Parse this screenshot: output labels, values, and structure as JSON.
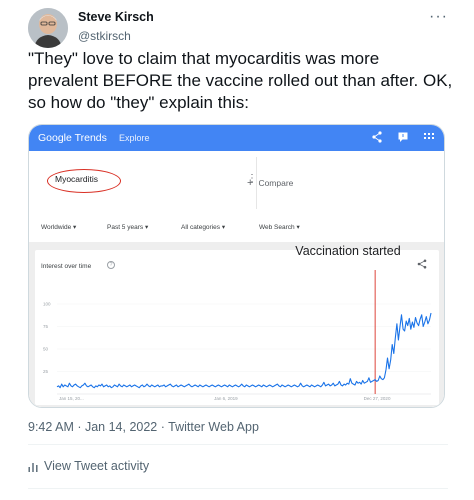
{
  "tweet": {
    "author_name": "Steve Kirsch",
    "author_handle": "@stkirsch",
    "text": "\"They\" love to claim that myocarditis was more prevalent BEFORE the vaccine rolled out than after. OK, so how do \"they\" explain this:",
    "timestamp": "9:42 AM · Jan 14, 2022 · Twitter Web App",
    "activity_label": "View Tweet activity"
  },
  "google_trends": {
    "logo": "Google Trends",
    "nav_explore": "Explore",
    "search_term": "Myocarditis",
    "compare_label": "Compare",
    "filters": [
      "Worldwide",
      "Past 5 years",
      "All categories",
      "Web Search"
    ],
    "panel_title": "Interest over time",
    "annotation": "Vaccination started",
    "colors": {
      "brand": "#4285f4",
      "line": "#1a73e8",
      "marker": "#d93025"
    }
  },
  "chart_data": {
    "type": "line",
    "title": "Interest over time",
    "ylim": [
      0,
      100
    ],
    "yticks": [
      25,
      50,
      75,
      100
    ],
    "xtick_labels": [
      "Jan 15, 20...",
      "Jan 6, 2019",
      "Dec 27, 2020"
    ],
    "annotation": {
      "label": "Vaccination started",
      "x_index": 205
    },
    "series": [
      {
        "values": [
          8,
          9,
          7,
          11,
          8,
          10,
          9,
          8,
          12,
          9,
          8,
          10,
          11,
          9,
          8,
          7,
          9,
          10,
          12,
          9,
          8,
          9,
          10,
          8,
          7,
          9,
          8,
          10,
          9,
          11,
          8,
          9,
          10,
          8,
          9,
          7,
          8,
          10,
          9,
          8,
          11,
          9,
          8,
          10,
          9,
          8,
          9,
          10,
          8,
          9,
          10,
          9,
          8,
          7,
          9,
          10,
          8,
          9,
          11,
          9,
          8,
          10,
          9,
          8,
          9,
          10,
          8,
          9,
          9,
          10,
          8,
          9,
          10,
          11,
          9,
          8,
          9,
          10,
          8,
          9,
          10,
          9,
          8,
          9,
          10,
          11,
          9,
          8,
          9,
          10,
          9,
          8,
          10,
          9,
          8,
          9,
          10,
          9,
          8,
          9,
          10,
          9,
          8,
          9,
          10,
          9,
          8,
          9,
          10,
          9,
          8,
          10,
          9,
          8,
          9,
          10,
          9,
          8,
          9,
          11,
          9,
          8,
          10,
          9,
          8,
          9,
          10,
          9,
          8,
          9,
          10,
          9,
          8,
          10,
          9,
          8,
          9,
          10,
          9,
          8,
          9,
          10,
          11,
          9,
          8,
          10,
          9,
          8,
          9,
          10,
          9,
          8,
          9,
          10,
          9,
          8,
          9,
          12,
          9,
          8,
          9,
          10,
          9,
          8,
          10,
          9,
          8,
          9,
          10,
          9,
          8,
          10,
          13,
          9,
          10,
          11,
          9,
          10,
          12,
          9,
          10,
          11,
          14,
          10,
          9,
          11,
          10,
          12,
          11,
          17,
          12,
          11,
          10,
          14,
          12,
          13,
          11,
          15,
          12,
          13,
          14,
          18,
          13,
          14,
          15,
          16,
          14,
          15,
          20,
          17,
          16,
          18,
          27,
          40,
          28,
          38,
          55,
          45,
          62,
          78,
          60,
          75,
          88,
          72,
          70,
          81,
          76,
          84,
          72,
          80,
          74,
          85,
          79,
          76,
          83,
          88,
          75,
          80,
          86,
          78,
          82,
          90
        ]
      }
    ]
  }
}
